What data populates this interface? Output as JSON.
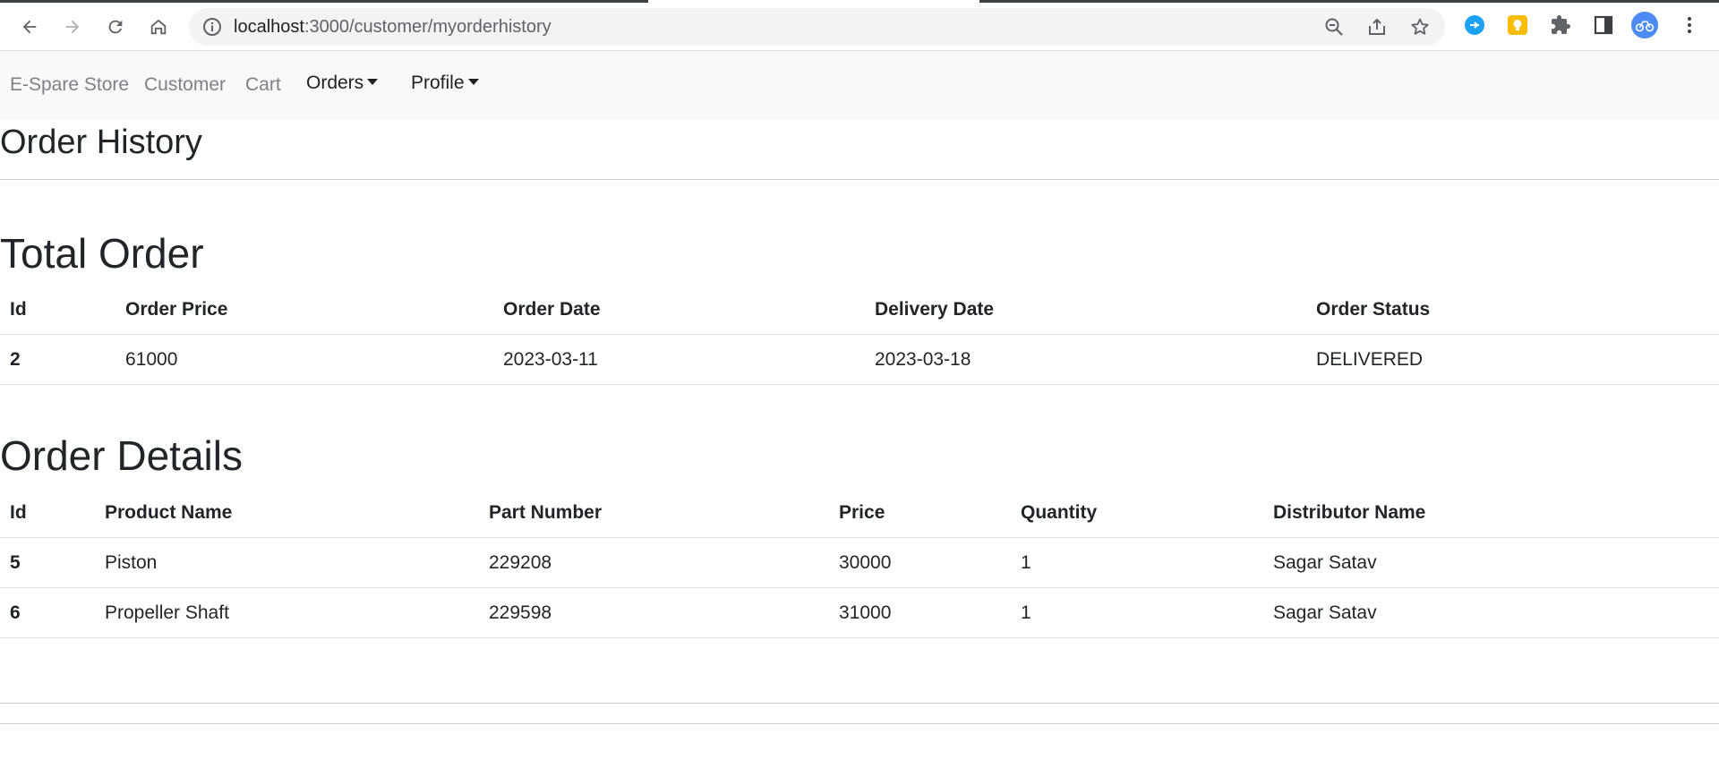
{
  "browser": {
    "url_host": "localhost",
    "url_rest": ":3000/customer/myorderhistory",
    "icons": [
      "back-arrow-icon",
      "forward-arrow-icon",
      "reload-icon",
      "home-icon",
      "info-icon",
      "zoom-out-icon",
      "share-icon",
      "star-icon",
      "extension-blue-icon",
      "extension-yellow-icon",
      "puzzle-icon",
      "side-panel-icon",
      "profile-avatar-icon",
      "more-vert-icon"
    ]
  },
  "navbar": {
    "brand": "E-Spare Store",
    "customer": "Customer",
    "cart": "Cart",
    "orders": "Orders",
    "profile": "Profile"
  },
  "page": {
    "title": "Order History"
  },
  "total_order": {
    "heading": "Total Order",
    "columns": [
      "Id",
      "Order Price",
      "Order Date",
      "Delivery Date",
      "Order Status"
    ],
    "rows": [
      [
        "2",
        "61000",
        "2023-03-11",
        "2023-03-18",
        "DELIVERED"
      ]
    ]
  },
  "order_details": {
    "heading": "Order Details",
    "columns": [
      "Id",
      "Product Name",
      "Part Number",
      "Price",
      "Quantity",
      "Distributor Name"
    ],
    "rows": [
      [
        "5",
        "Piston",
        "229208",
        "30000",
        "1",
        "Sagar Satav"
      ],
      [
        "6",
        "Propeller Shaft",
        "229598",
        "31000",
        "1",
        "Sagar Satav"
      ]
    ]
  },
  "colors": {
    "navbar_bg": "#f8f9fa",
    "text": "#212529",
    "muted_link": "#7d8186",
    "omnibox_bg": "#f1f3f4"
  }
}
